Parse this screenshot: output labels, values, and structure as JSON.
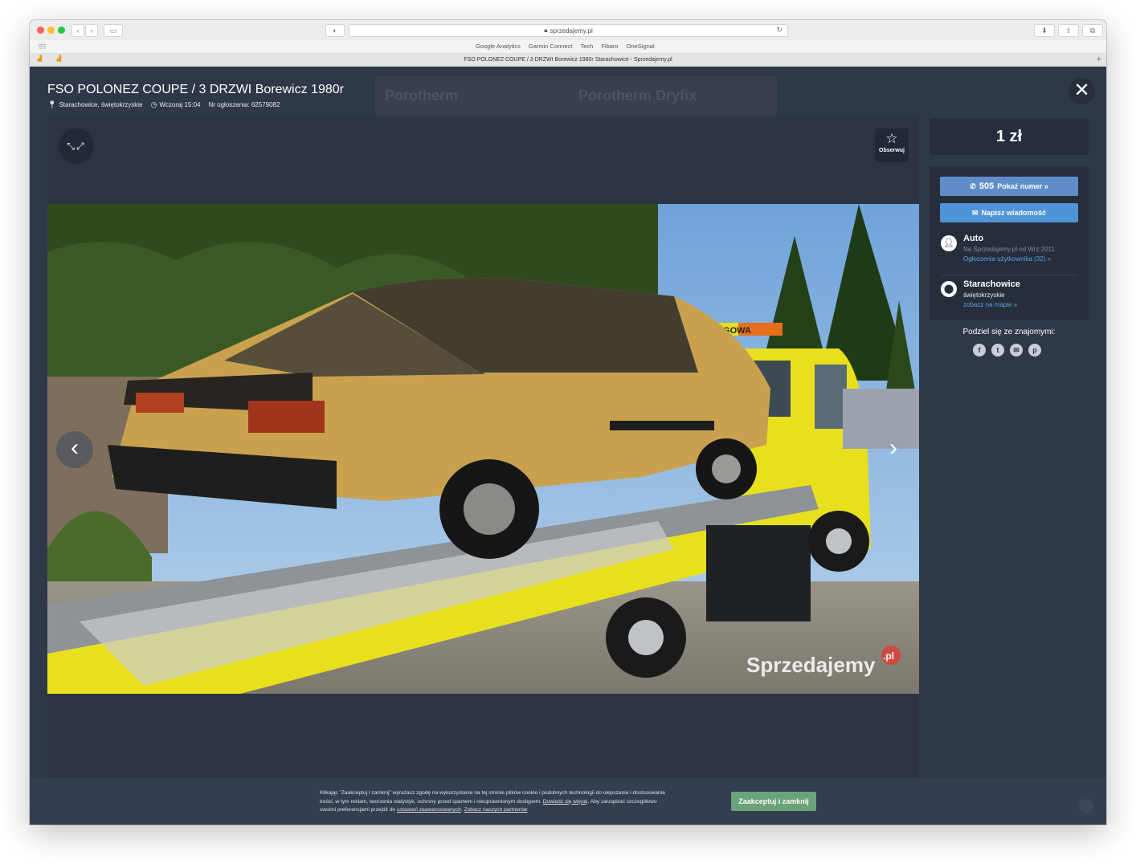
{
  "browser": {
    "address": "sprzedajemy.pl",
    "bookmarks": [
      "Google Analytics",
      "Garmin Connect",
      "Tech",
      "Fibaro",
      "OneSignal"
    ],
    "tab_title": "FSO POLONEZ COUPE / 3 DRZWI Borewicz 1980r Starachowice - Sprzedajemy.pl"
  },
  "listing": {
    "title": "FSO POLONEZ COUPE / 3 DRZWI Borewicz 1980r",
    "location": "Starachowice, świętokrzyskie",
    "date": "Wczoraj 15:04",
    "ad_number": "Nr ogłoszenia: 62579082",
    "price": "1 zł"
  },
  "banner": {
    "left": "Porotherm",
    "right": "Porotherm Dryfix"
  },
  "gallery": {
    "watch_label": "Obserwuj",
    "photo_watermark": "Sprzedajemy",
    "photo_watermark_suffix": ".pl",
    "truck_text": "POMOC DROGOWA"
  },
  "seller": {
    "phone_prefix": "505",
    "phone_label": "Pokaż numer »",
    "message_label": "Napisz wiadomość",
    "name": "Auto",
    "since": "Na Sprzedajemy.pl od Wrz 2011",
    "ads_link": "Ogłoszenia użytkownika (32) »",
    "city": "Starachowice",
    "region": "świętokrzyskie",
    "map_link": "zobacz na mapie »"
  },
  "share": {
    "label": "Podziel się ze znajomymi:",
    "icons": [
      "facebook-icon",
      "twitter-icon",
      "email-icon",
      "pinterest-icon"
    ]
  },
  "cookie": {
    "text_1": "Klikając \"Zaakceptuj i zamknij\" wyrażasz zgodę na wykorzystanie na tej stronie plików cookie i podobnych technologii do ulepszania i dostosowania treści, w tym reklam, tworzenia statystyk, ochrony przed spamem i nieuprawnionym dostępem.",
    "link_more": "Dowiedz się więcej",
    "text_2": "Aby zarządzać szczegółowo swoimi preferencjami przejdź do",
    "link_settings": "ustawień zaawansowanych",
    "link_partners": "Zobacz naszych partnerów",
    "accept_label": "Zaakceptuj i zamknij"
  },
  "colors": {
    "page_bg": "#2f3849",
    "panel_bg": "#262e3c",
    "phone_button": "#5f8dc9",
    "message_button": "#4f94d8",
    "accept_button": "#6aa27a",
    "link": "#5aa1e3"
  }
}
